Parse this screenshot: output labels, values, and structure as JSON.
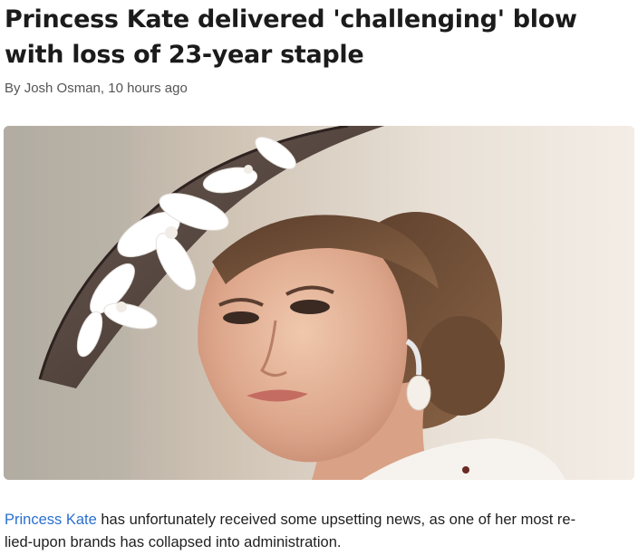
{
  "article": {
    "headline_line1": "Princess Kate delivered 'challenging' blow",
    "headline_line2": "with loss of 23-year staple",
    "byline_prefix": "By ",
    "author": "Josh Osman",
    "separator": ", ",
    "time_ago": "10 hours ago",
    "hero_image": "portrait-photo-woman-wide-brim-hat-white-flowers-drop-earring",
    "paragraph_link": "Princess Kate",
    "paragraph_line1_rest": " has unfortunately received some upsetting news, as one of her most re-",
    "paragraph_line2": "lied-upon brands has collapsed into administration."
  },
  "colors": {
    "link": "#2a6fd1",
    "headline": "#1b1b1b",
    "byline": "#555555",
    "body": "#1f1f1f"
  }
}
